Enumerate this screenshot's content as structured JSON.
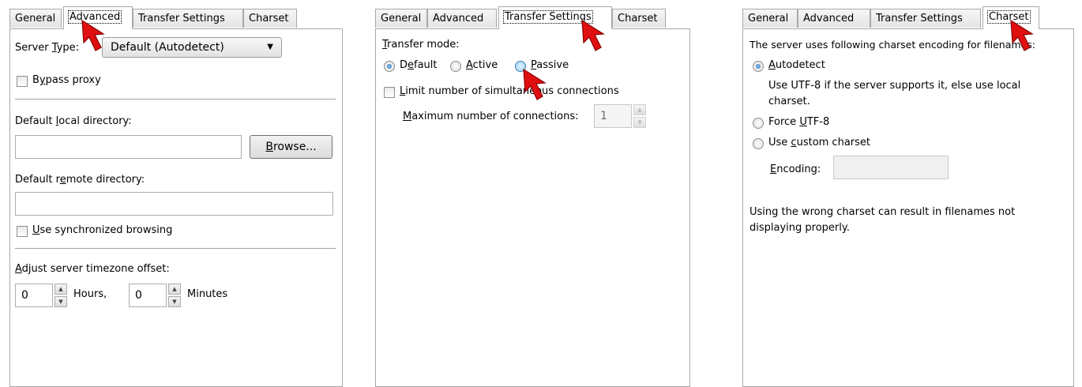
{
  "panels": [
    {
      "tabs": [
        "General",
        "Advanced",
        "Transfer Settings",
        "Charset"
      ],
      "active_tab": "Advanced",
      "server_type_label": "Server Type:",
      "server_type_value": "Default (Autodetect)",
      "bypass_proxy": "Bypass proxy",
      "local_dir_label": "Default local directory:",
      "local_dir_value": "",
      "browse_button": "Browse...",
      "remote_dir_label": "Default remote directory:",
      "remote_dir_value": "",
      "sync_browsing": "Use synchronized browsing",
      "timezone_label": "Adjust server timezone offset:",
      "hours_value": "0",
      "hours_label": "Hours,",
      "minutes_value": "0",
      "minutes_label": "Minutes"
    },
    {
      "tabs": [
        "General",
        "Advanced",
        "Transfer Settings",
        "Charset"
      ],
      "active_tab": "Transfer Settings",
      "transfer_mode_label": "Transfer mode:",
      "mode_default": "Default",
      "mode_active": "Active",
      "mode_passive": "Passive",
      "selected_mode": "Default",
      "limit_connections": "Limit number of simultaneous connections",
      "max_connections_label": "Maximum number of connections:",
      "max_connections_value": "1"
    },
    {
      "tabs": [
        "General",
        "Advanced",
        "Transfer Settings",
        "Charset"
      ],
      "active_tab": "Charset",
      "intro": "The server uses following charset encoding for filenames:",
      "autodetect": "Autodetect",
      "autodetect_desc_1": "Use UTF-8 if the server supports it, else use local",
      "autodetect_desc_2": "charset.",
      "force_utf8": "Force UTF-8",
      "custom_charset": "Use custom charset",
      "encoding_label": "Encoding:",
      "encoding_value": "",
      "warning_1": "Using the wrong charset can result in filenames not",
      "warning_2": "displaying properly.",
      "selected_option": "Autodetect"
    }
  ],
  "colors": {
    "cursor_red": "#e01010",
    "border": "#a8a8a8",
    "radio_selected": "#2a6fb3"
  }
}
